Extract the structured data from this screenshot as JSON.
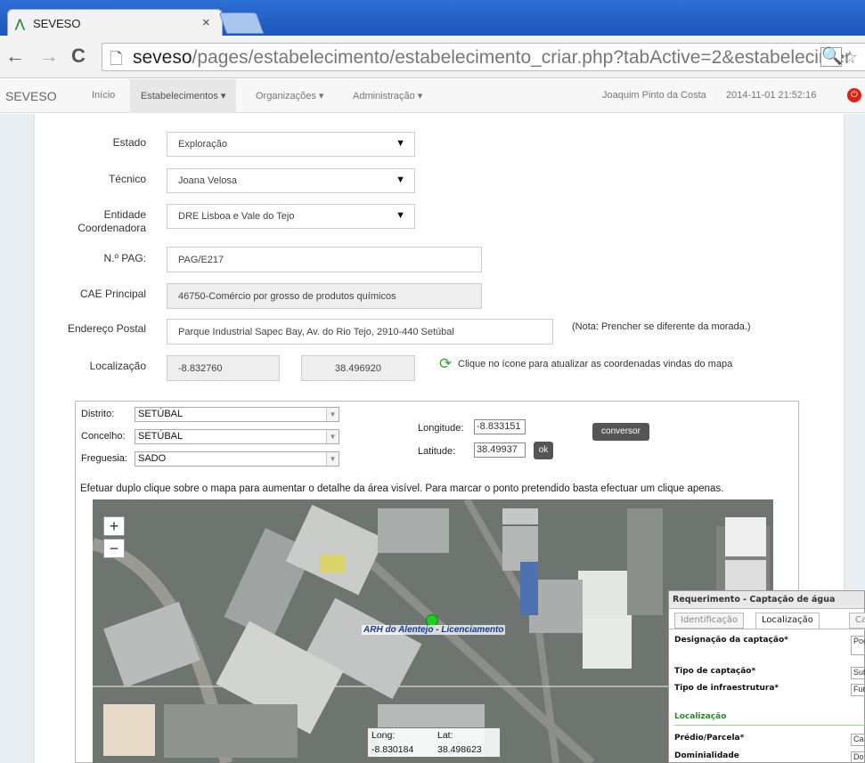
{
  "browser": {
    "tab_title": "SEVESO",
    "tab_close": "×",
    "url_host": "seveso",
    "url_path": "/pages/estabelecimento/estabelecimento_criar.php?tabActive=2&estabelecimer"
  },
  "navbar": {
    "brand": "SEVESO",
    "items": [
      "Início",
      "Estabelecimentos ▾",
      "Organizações ▾",
      "Administração ▾"
    ],
    "active_index": 1,
    "user": "Joaquim Pinto da Costa",
    "datetime": "2014-11-01 21:52:16"
  },
  "form": {
    "estado_label": "Estado",
    "estado_value": "Exploração",
    "tecnico_label": "Técnico",
    "tecnico_value": "Joana Velosa",
    "entidade_label_1": "Entidade",
    "entidade_label_2": "Coordenadora",
    "entidade_value": "DRE Lisboa e Vale do Tejo",
    "npag_label": "N.º PAG:",
    "npag_value": "PAG/E217",
    "cae_label": "CAE Principal",
    "cae_value": "46750-Comércio por grosso de produtos químicos",
    "endereco_label": "Endereço Postal",
    "endereco_value": "Parque Industrial Sapec Bay, Av. do Rio Tejo, 2910-440 Setúbal",
    "endereco_note": "(Nota: Prencher se diferente da morada.)",
    "localizacao_label": "Localização",
    "long_value": "-8.832760",
    "lat_value": "38.496920",
    "refresh_note": "Clique no ícone para atualizar as coordenadas vindas do mapa"
  },
  "map_panel": {
    "distrito_label": "Distrito:",
    "distrito_value": "SETÚBAL",
    "concelho_label": "Concelho:",
    "concelho_value": "SETÚBAL",
    "freguesia_label": "Freguesia:",
    "freguesia_value": "SADO",
    "longitude_label": "Longitude:",
    "longitude_value": "-8.833151",
    "latitude_label": "Latitude:",
    "latitude_value": "38.49937",
    "ok_label": "ok",
    "conversor_label": "conversor",
    "hint": "Efetuar duplo clique sobre o mapa para aumentar o detalhe da área visível. Para marcar o ponto pretendido basta efectuar um clique apenas.",
    "zoom_in": "+",
    "zoom_out": "−",
    "marker_label": "ARH do Alentejo - Licenciamento",
    "cursor_long_label": "Long:",
    "cursor_lat_label": "Lat:",
    "cursor_long": "-8.830184",
    "cursor_lat": "38.498623"
  },
  "popup": {
    "title": "Requerimento - Captação de água",
    "tabs": [
      "Identificação",
      "Localização",
      "Ca"
    ],
    "designacao_label": "Designação da captação*",
    "designacao_value": "Poç",
    "tipo_captacao_label": "Tipo de captação*",
    "tipo_captacao_value": "Sub",
    "tipo_infra_label": "Tipo de infraestrutura*",
    "tipo_infra_value": "Fur",
    "section_localizacao": "Localização",
    "predio_label": "Prédio/Parcela*",
    "predio_value": "Ca",
    "dominialidade_label": "Dominialidade",
    "dominialidade_value": "Do"
  }
}
